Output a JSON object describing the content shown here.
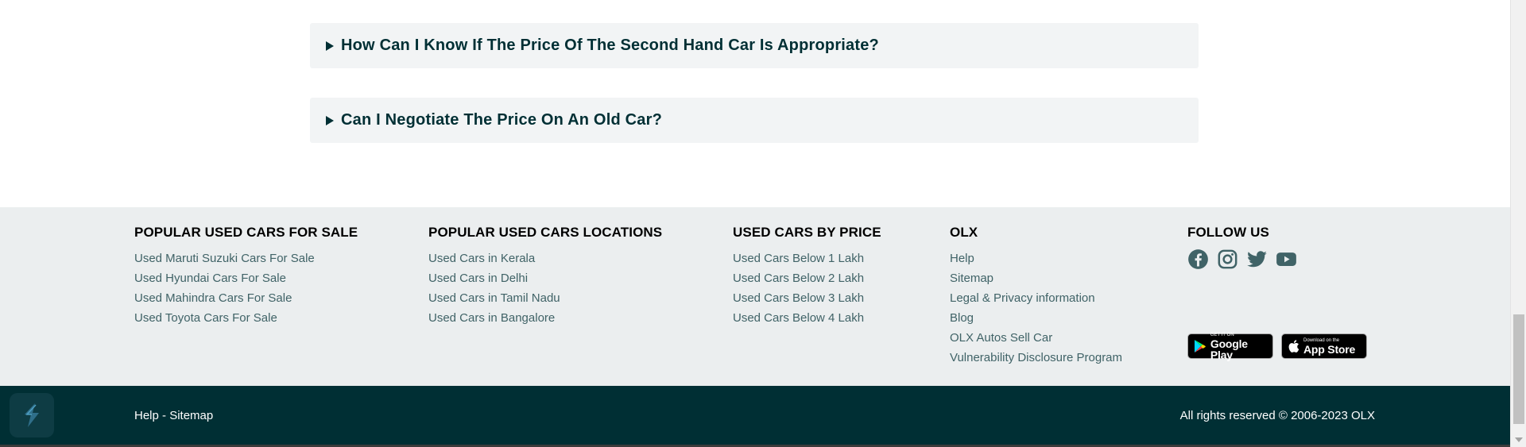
{
  "faq": [
    {
      "question": "How Can I Know If The Price Of The Second Hand Car Is Appropriate?"
    },
    {
      "question": "Can I Negotiate The Price On An Old Car?"
    }
  ],
  "footer": {
    "columns": [
      {
        "heading": "POPULAR USED CARS FOR SALE",
        "links": [
          "Used Maruti Suzuki Cars For Sale",
          "Used Hyundai Cars For Sale",
          "Used Mahindra Cars For Sale",
          "Used Toyota Cars For Sale"
        ]
      },
      {
        "heading": "POPULAR USED CARS LOCATIONS",
        "links": [
          "Used Cars in Kerala",
          "Used Cars in Delhi",
          "Used Cars in Tamil Nadu",
          "Used Cars in Bangalore"
        ]
      },
      {
        "heading": "USED CARS BY PRICE",
        "links": [
          "Used Cars Below 1 Lakh",
          "Used Cars Below 2 Lakh",
          "Used Cars Below 3 Lakh",
          "Used Cars Below 4 Lakh"
        ]
      },
      {
        "heading": "OLX",
        "links": [
          "Help",
          "Sitemap",
          "Legal & Privacy information",
          "Blog",
          "OLX Autos Sell Car",
          "Vulnerability Disclosure Program"
        ]
      }
    ],
    "follow": {
      "heading": "FOLLOW US",
      "icons": [
        "facebook-icon",
        "instagram-icon",
        "twitter-icon",
        "youtube-icon"
      ],
      "stores": [
        {
          "small": "GET IT ON",
          "large": "Google Play"
        },
        {
          "small": "Download on the",
          "large": "App Store"
        }
      ]
    },
    "bottom": {
      "help": "Help",
      "separator": " - ",
      "sitemap": "Sitemap",
      "copyright": "All rights reserved © 2006-2023 OLX"
    }
  },
  "colors": {
    "footer_bg": "#ebeeef",
    "bottom_bar_bg": "#002f34",
    "link_color": "#406367",
    "faq_bg": "#f2f4f5"
  }
}
